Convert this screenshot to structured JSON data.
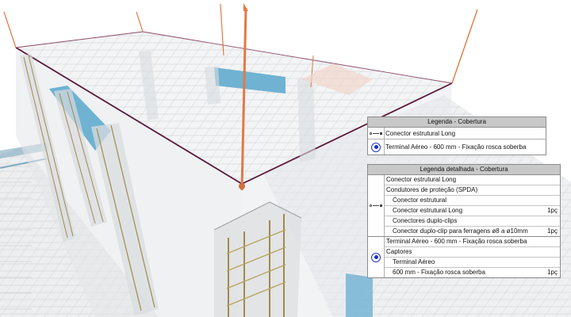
{
  "legend_cobertura": {
    "title": "Legenda - Cobertura",
    "rows": [
      {
        "symbol": "connector-symbol",
        "label": "Conector estrutural Long"
      },
      {
        "symbol": "air-terminal-symbol",
        "label": "Terminal Aéreo - 600 mm - Fixação rosca soberba"
      }
    ]
  },
  "legend_detalhada": {
    "title": "Legenda detalhada - Cobertura",
    "groups": [
      {
        "symbol": "connector-symbol",
        "lines": [
          {
            "label": "Conector estrutural Long",
            "qty": ""
          },
          {
            "label": "Condutores de proteção (SPDA)",
            "qty": ""
          },
          {
            "label": "Conector estrutural",
            "qty": ""
          },
          {
            "label": "Conector estrutural Long",
            "qty": "1pç"
          },
          {
            "label": "Conectores duplo-clips",
            "qty": ""
          },
          {
            "label": "Conector duplo-clip para ferragens ø8 a ø10mm",
            "qty": "1pç"
          }
        ]
      },
      {
        "symbol": "air-terminal-symbol",
        "lines": [
          {
            "label": "Terminal Aéreo - 600 mm - Fixação rosca soberba",
            "qty": ""
          },
          {
            "label": "Captores",
            "qty": ""
          },
          {
            "label": "Terminal Aéreo",
            "qty": ""
          },
          {
            "label": "600 mm - Fixação rosca soberba",
            "qty": "1pç"
          }
        ]
      }
    ]
  },
  "colors": {
    "roof_outline": "#5a1a3c",
    "air_terminal": "#e07a45",
    "beam_blue": "#6fb2d2",
    "rebar": "#a08a4a",
    "symbol_blue": "#1a2fd0"
  }
}
